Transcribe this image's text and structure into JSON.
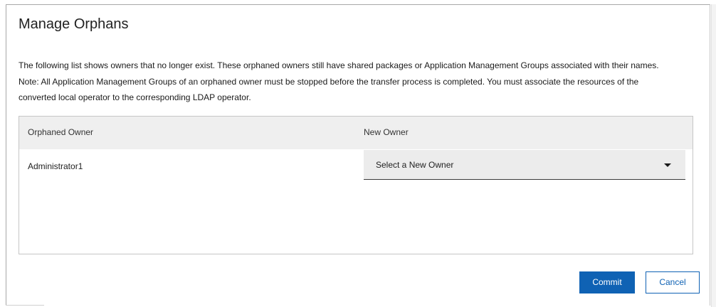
{
  "dialog": {
    "title": "Manage Orphans",
    "description_lines": [
      "The following list shows owners that no longer exist. These orphaned owners still have shared packages or Application Management Groups associated with their names.",
      "Note: All Application Management Groups of an orphaned owner must be stopped before the transfer process is completed. You must associate the resources of the",
      "converted local operator to the corresponding LDAP operator."
    ]
  },
  "table": {
    "columns": [
      "Orphaned Owner",
      "New Owner"
    ],
    "rows": [
      {
        "orphaned_owner": "Administrator1",
        "new_owner_select": {
          "selected": "Select a New Owner",
          "icon": "chevron-down-icon"
        }
      }
    ]
  },
  "actions": {
    "commit_label": "Commit",
    "cancel_label": "Cancel"
  },
  "colors": {
    "primary": "#0f62b4",
    "header_bg": "#efefef",
    "select_bg": "#ececec"
  }
}
